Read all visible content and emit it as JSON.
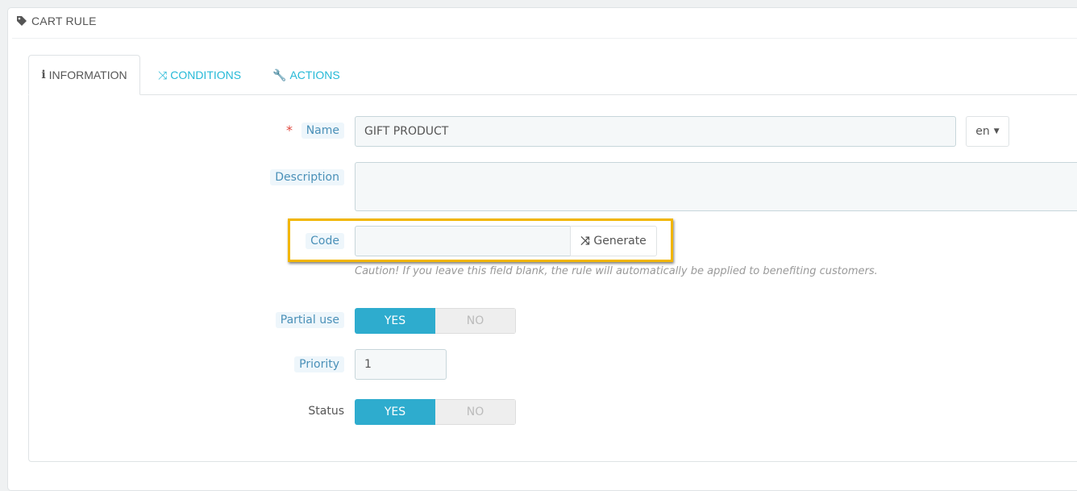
{
  "panel": {
    "title": "CART RULE",
    "icon": "tag-icon"
  },
  "tabs": [
    {
      "label": "INFORMATION",
      "icon": "info-icon",
      "active": true
    },
    {
      "label": "CONDITIONS",
      "icon": "random-icon",
      "active": false
    },
    {
      "label": "ACTIONS",
      "icon": "wrench-icon",
      "active": false
    }
  ],
  "form": {
    "name": {
      "label": "Name",
      "required": "*",
      "value": "GIFT PRODUCT",
      "lang": "en"
    },
    "description": {
      "label": "Description",
      "value": ""
    },
    "code": {
      "label": "Code",
      "value": "",
      "generate_label": "Generate",
      "help": "Caution! If you leave this field blank, the rule will automatically be applied to benefiting customers."
    },
    "partial_use": {
      "label": "Partial use",
      "yes": "YES",
      "no": "NO",
      "selected": "YES"
    },
    "priority": {
      "label": "Priority",
      "value": "1"
    },
    "status": {
      "label": "Status",
      "yes": "YES",
      "no": "NO",
      "selected": "YES"
    }
  },
  "colors": {
    "accent": "#25b9d7",
    "toggle_on": "#2eacce",
    "highlight": "#f2b600"
  }
}
